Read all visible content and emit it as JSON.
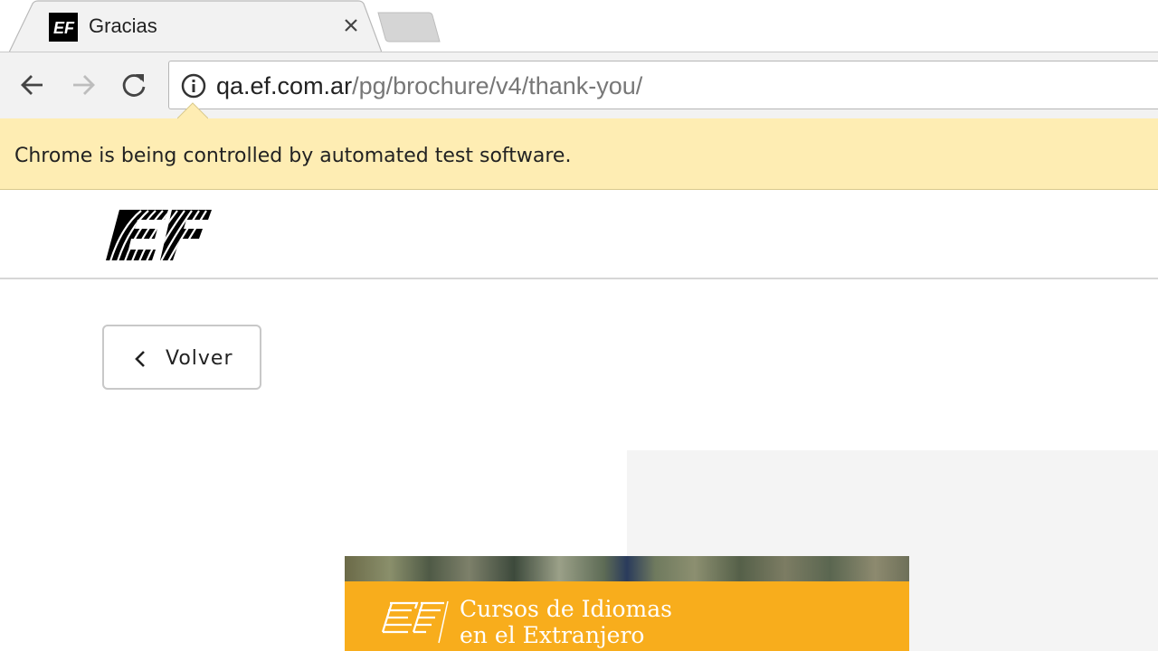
{
  "browser": {
    "tab": {
      "title": "Gracias",
      "favicon": "ef-favicon-icon",
      "close_icon": "close-icon"
    },
    "new_tab_icon": "new-tab-icon",
    "toolbar": {
      "back_icon": "back-arrow-icon",
      "forward_icon": "forward-arrow-icon",
      "reload_icon": "reload-icon",
      "info_icon": "info-icon",
      "url_host": "qa.ef.com.ar",
      "url_path": "/pg/brochure/v4/thank-you/"
    },
    "infobar": {
      "message": "Chrome is being controlled by automated test software.",
      "background": "#feedb3"
    }
  },
  "page": {
    "header": {
      "logo": "ef-logo"
    },
    "back_button": {
      "label": "Volver",
      "icon": "chevron-left-icon"
    },
    "brochure": {
      "title_line1": "Cursos de Idiomas",
      "title_line2": "en el Extranjero",
      "band_color": "#f8ad1c",
      "logo": "ef-logo"
    }
  }
}
